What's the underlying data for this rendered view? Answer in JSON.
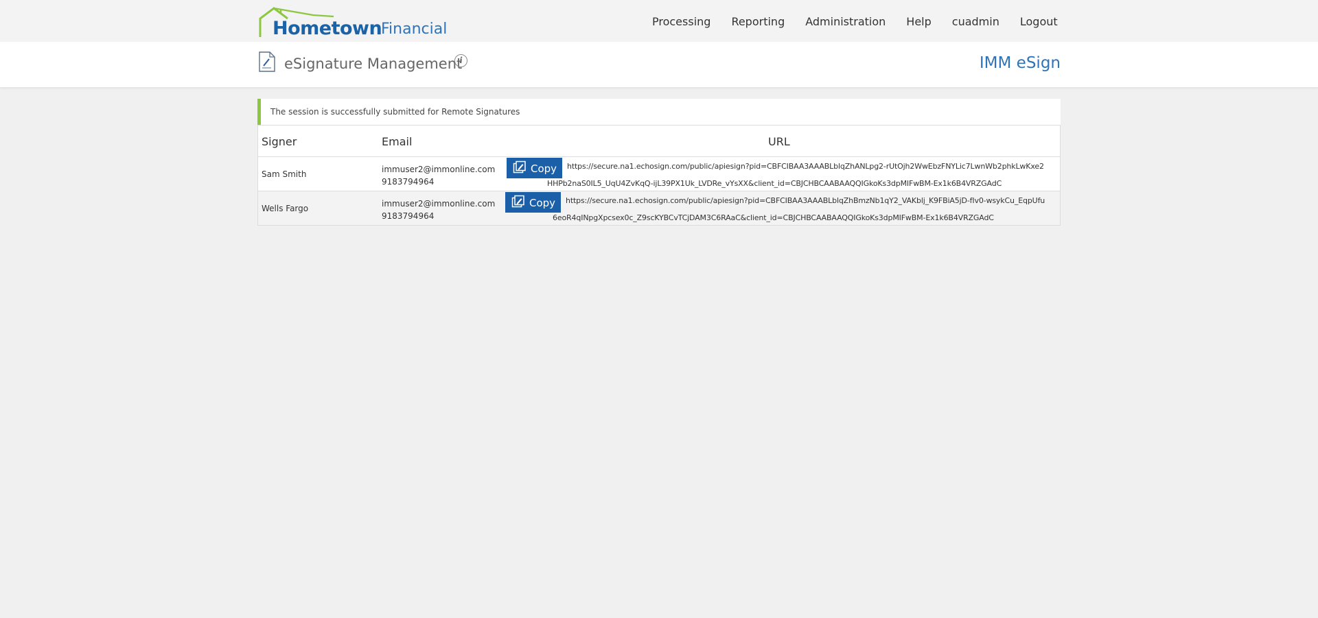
{
  "brand": {
    "name_main": "Hometown",
    "name_sub": "Financial",
    "color_main": "#1b63a6",
    "roof_color": "#8dc63f"
  },
  "nav": {
    "items": [
      {
        "label": "Processing"
      },
      {
        "label": "Reporting"
      },
      {
        "label": "Administration"
      },
      {
        "label": "Help"
      },
      {
        "label": "cuadmin"
      },
      {
        "label": "Logout"
      }
    ]
  },
  "header": {
    "title": "eSignature Management",
    "icon": "document-sign-icon",
    "info_icon_glyph": "i",
    "app_name": "IMM eSign"
  },
  "alert": {
    "message": "The session is successfully submitted for Remote Signatures",
    "accent_color": "#8dc63f"
  },
  "table": {
    "headers": {
      "signer": "Signer",
      "email": "Email",
      "url": "URL"
    },
    "copy_label": "Copy",
    "rows": [
      {
        "signer": "Sam Smith",
        "email": "immuser2@immonline.com",
        "phone": "9183794964",
        "url_line1": "https://secure.na1.echosign.com/public/apiesign?pid=CBFCIBAA3AAABLblqZhANLpg2-rUtOjh2WwEbzFNYLic7LwnWb2phkLwKxe2",
        "url_line2": "HHPb2naS0IL5_UqU4ZvKqQ-ijL39PX1Uk_LVDRe_vYsXX&client_id=CBJCHBCAABAAQQIGkoKs3dpMIFwBM-Ex1k6B4VRZGAdC"
      },
      {
        "signer": "Wells Fargo",
        "email": "immuser2@immonline.com",
        "phone": "9183794964",
        "url_line1": "https://secure.na1.echosign.com/public/apiesign?pid=CBFCIBAA3AAABLblqZhBmzNb1qY2_VAKblj_K9FBiA5jD-fIv0-wsykCu_EqpUfu",
        "url_line2": "6eoR4qINpgXpcsex0c_Z9scKYBCvTCjDAM3C6RAaC&client_id=CBJCHBCAABAAQQIGkoKs3dpMIFwBM-Ex1k6B4VRZGAdC"
      }
    ]
  },
  "colors": {
    "page_bg": "#f0f0f0",
    "accent_blue": "#1b5fa8",
    "title_blue": "#2f73b8"
  }
}
